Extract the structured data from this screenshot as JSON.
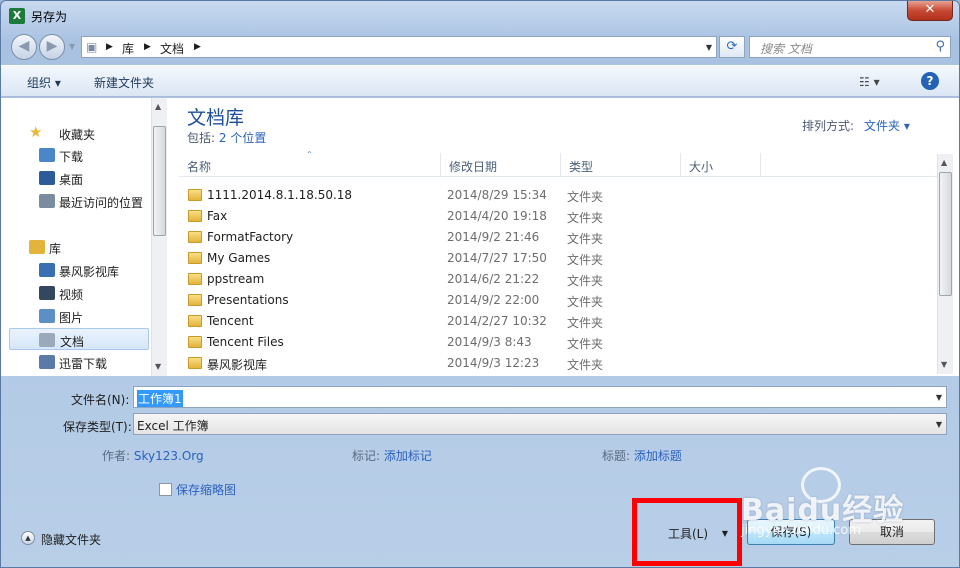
{
  "window": {
    "title": "另存为",
    "close_label": "✕"
  },
  "nav": {
    "breadcrumb": [
      "库",
      "文档"
    ],
    "search_placeholder": "搜索 文档"
  },
  "toolbar": {
    "organize": "组织 ▾",
    "new_folder": "新建文件夹"
  },
  "sidebar": {
    "items": [
      {
        "label": "收藏夹",
        "icon": "star-icon",
        "color": "#e8b83a"
      },
      {
        "label": "下载",
        "icon": "download-folder-icon",
        "color": "#4a86c8"
      },
      {
        "label": "桌面",
        "icon": "desktop-icon",
        "color": "#2c5b9a"
      },
      {
        "label": "最近访问的位置",
        "icon": "recent-places-icon",
        "color": "#7c8ca0"
      },
      {
        "label": "库",
        "icon": "library-icon",
        "color": "#e3b43c"
      },
      {
        "label": "暴风影视库",
        "icon": "video-library-icon",
        "color": "#3a6fb3"
      },
      {
        "label": "视频",
        "icon": "video-icon",
        "color": "#33475f"
      },
      {
        "label": "图片",
        "icon": "pictures-icon",
        "color": "#5c8fc4"
      },
      {
        "label": "文档",
        "icon": "documents-icon",
        "color": "#9aa9bc"
      },
      {
        "label": "迅雷下载",
        "icon": "thunder-download-icon",
        "color": "#5a7aa8"
      }
    ]
  },
  "library": {
    "title": "文档库",
    "includes_prefix": "包括:",
    "includes_link": "2 个位置",
    "sort_label": "排列方式:",
    "sort_value": "文件夹 ▾"
  },
  "columns": [
    "名称",
    "修改日期",
    "类型",
    "大小"
  ],
  "files": [
    {
      "name": "1111.2014.8.1.18.50.18",
      "date": "2014/8/29 15:34",
      "type": "文件夹"
    },
    {
      "name": "Fax",
      "date": "2014/4/20 19:18",
      "type": "文件夹"
    },
    {
      "name": "FormatFactory",
      "date": "2014/9/2 21:46",
      "type": "文件夹"
    },
    {
      "name": "My Games",
      "date": "2014/7/27 17:50",
      "type": "文件夹"
    },
    {
      "name": "ppstream",
      "date": "2014/6/2 21:22",
      "type": "文件夹"
    },
    {
      "name": "Presentations",
      "date": "2014/9/2 22:00",
      "type": "文件夹"
    },
    {
      "name": "Tencent",
      "date": "2014/2/27 10:32",
      "type": "文件夹"
    },
    {
      "name": "Tencent Files",
      "date": "2014/9/3 8:43",
      "type": "文件夹"
    },
    {
      "name": "暴风影视库",
      "date": "2014/9/3 12:23",
      "type": "文件夹"
    }
  ],
  "form": {
    "filename_label": "文件名(N):",
    "filename_value": "工作簿1",
    "filetype_label": "保存类型(T):",
    "filetype_value": "Excel 工作簿",
    "author_label": "作者:",
    "author_value": "Sky123.Org",
    "tags_label": "标记:",
    "tags_value": "添加标记",
    "title_label": "标题:",
    "title_value": "添加标题",
    "thumbnail_label": "保存缩略图",
    "hide_folders_label": "隐藏文件夹",
    "tools_label": "工具(L)",
    "save_label": "保存(S)",
    "cancel_label": "取消"
  },
  "watermark": {
    "text": "Baidu经验",
    "url": "jingyan.baidu.com"
  }
}
